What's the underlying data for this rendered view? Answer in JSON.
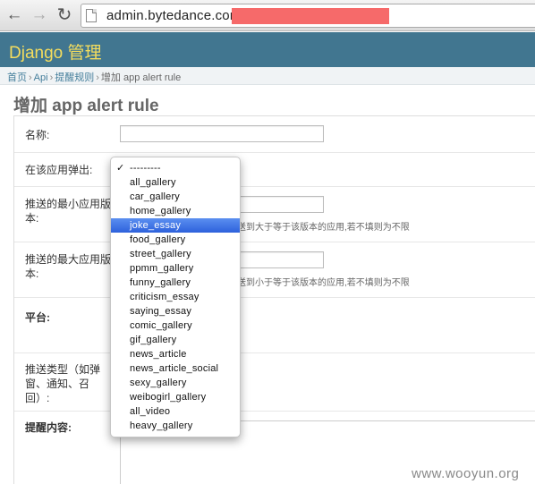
{
  "browser": {
    "url": "admin.bytedance.com",
    "back_icon": "arrow-left-icon",
    "forward_icon": "arrow-right-icon",
    "reload_icon": "reload-icon"
  },
  "header": {
    "title": "Django 管理"
  },
  "breadcrumb": {
    "items": [
      "首页",
      "Api",
      "提醒规则"
    ],
    "current": "增加 app alert rule"
  },
  "page_title": "增加 app alert rule",
  "form": {
    "name_label": "名称:",
    "app_label": "在该应用弹出:",
    "min_version_label": "推送的最小应用版本:",
    "min_version_help": "送到大于等于该版本的应用,若不填则为不限",
    "max_version_label": "推送的最大应用版本:",
    "max_version_help": "送到小于等于该版本的应用,若不填则为不限",
    "platform_label": "平台:",
    "push_type_label": "推送类型（如弹窗、通知、召回）:",
    "content_label": "提醒内容:"
  },
  "dropdown": {
    "selected_index": 0,
    "highlighted_index": 4,
    "options": [
      "---------",
      "all_gallery",
      "car_gallery",
      "home_gallery",
      "joke_essay",
      "food_gallery",
      "street_gallery",
      "ppmm_gallery",
      "funny_gallery",
      "criticism_essay",
      "saying_essay",
      "comic_gallery",
      "gif_gallery",
      "news_article",
      "news_article_social",
      "sexy_gallery",
      "weibogirl_gallery",
      "all_video",
      "heavy_gallery"
    ]
  },
  "watermark": "www.wooyun.org"
}
